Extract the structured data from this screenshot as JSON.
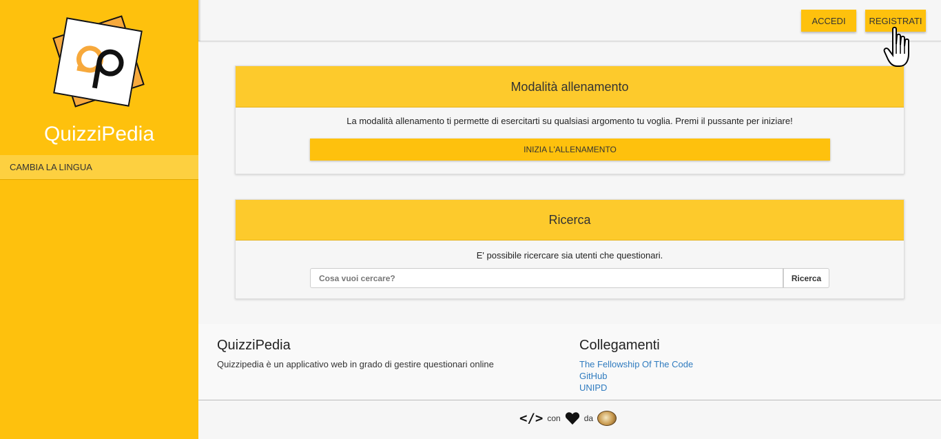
{
  "sidebar": {
    "brand": "QuizziPedia",
    "lang_label": "CAMBIA LA LINGUA"
  },
  "topbar": {
    "login_label": "ACCEDI",
    "register_label": "REGISTRATI"
  },
  "training_card": {
    "title": "Modalità allenamento",
    "description": "La modalità allenamento ti permette di esercitarti su qualsiasi argomento tu voglia. Premi il pussante per iniziare!",
    "button_label": "INIZIA L'ALLENAMENTO"
  },
  "search_card": {
    "title": "Ricerca",
    "description": "E' possibile ricercare sia utenti che questionari.",
    "placeholder": "Cosa vuoi cercare?",
    "button_label": "Ricerca"
  },
  "footer": {
    "about_title": "QuizziPedia",
    "about_text": "Quizzipedia è un applicativo web in grado di gestire questionari online",
    "links_title": "Collegamenti",
    "links": [
      "The Fellowship Of The Code",
      "GitHub",
      "UNIPD"
    ]
  },
  "credits": {
    "code_symbol": "</>",
    "con": "con",
    "da": "da"
  },
  "colors": {
    "accent": "#fec10d",
    "card_header": "#fdca2c",
    "link": "#2f7bbf"
  }
}
